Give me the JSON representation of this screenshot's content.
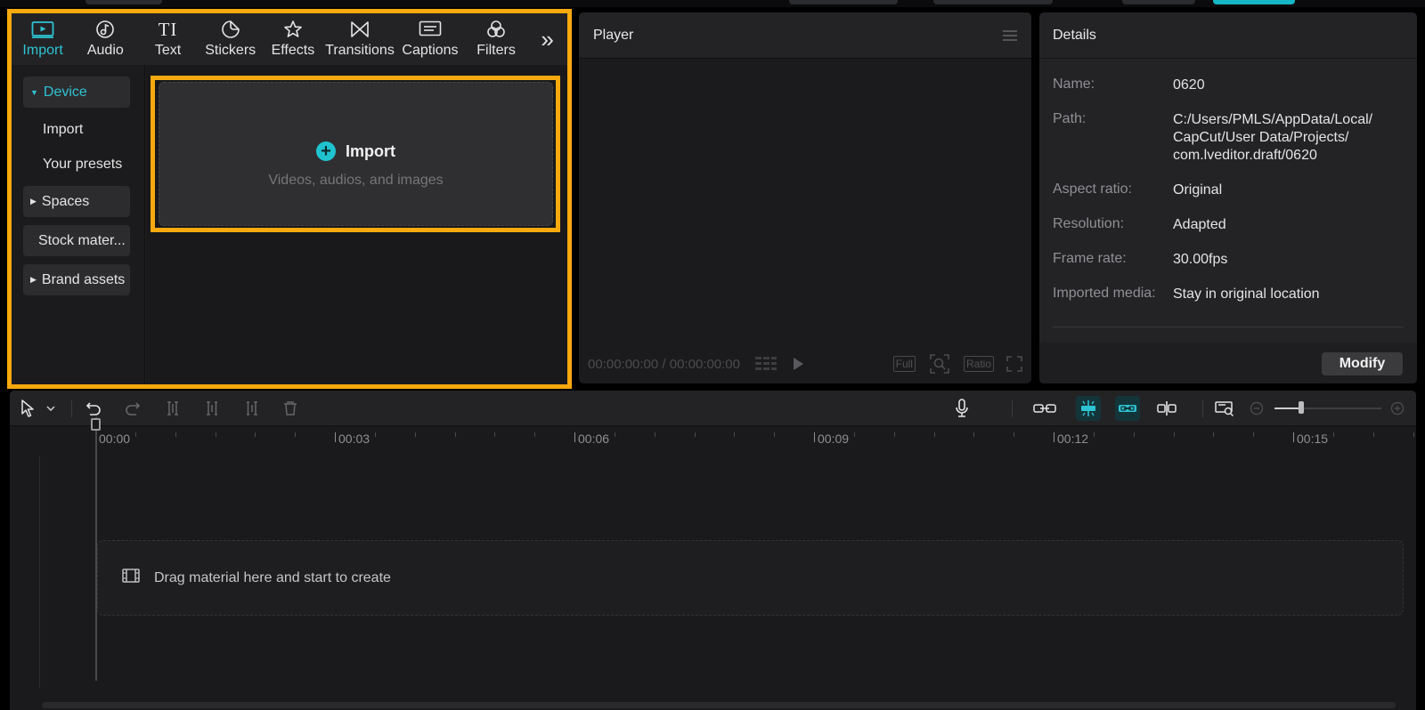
{
  "colors": {
    "accent": "#2ec3d1",
    "highlight": "#f7a90e",
    "panel": "#232326"
  },
  "media": {
    "tabs": [
      {
        "label": "Import",
        "icon": "import-icon",
        "active": true
      },
      {
        "label": "Audio",
        "icon": "audio-icon"
      },
      {
        "label": "Text",
        "icon": "text-icon",
        "glyph": "TI"
      },
      {
        "label": "Stickers",
        "icon": "stickers-icon"
      },
      {
        "label": "Effects",
        "icon": "effects-icon"
      },
      {
        "label": "Transitions",
        "icon": "transitions-icon"
      },
      {
        "label": "Captions",
        "icon": "captions-icon"
      },
      {
        "label": "Filters",
        "icon": "filters-icon"
      }
    ],
    "more_glyph": "»",
    "sidebar": {
      "device": "Device",
      "import": "Import",
      "presets": "Your presets",
      "spaces": "Spaces",
      "stock": "Stock mater...",
      "brand": "Brand assets"
    },
    "import_box": {
      "title": "Import",
      "subtitle": "Videos, audios, and images",
      "plus": "+"
    }
  },
  "player": {
    "title": "Player",
    "timecode": "00:00:00:00 / 00:00:00:00",
    "full_label": "Full",
    "ratio_label": "Ratio"
  },
  "details": {
    "title": "Details",
    "rows": [
      {
        "label": "Name:",
        "value": "0620"
      },
      {
        "label": "Path:",
        "value": "C:/Users/PMLS/AppData/Local/ CapCut/User Data/Projects/ com.lveditor.draft/0620"
      },
      {
        "label": "Aspect ratio:",
        "value": "Original"
      },
      {
        "label": "Resolution:",
        "value": "Adapted"
      },
      {
        "label": "Frame rate:",
        "value": "30.00fps"
      },
      {
        "label": "Imported media:",
        "value": "Stay in original location"
      }
    ],
    "modify_label": "Modify"
  },
  "timeline": {
    "ruler": [
      "00:00",
      "00:03",
      "00:06",
      "00:09",
      "00:12",
      "00:15"
    ],
    "drop_text": "Drag material here and start to create"
  }
}
